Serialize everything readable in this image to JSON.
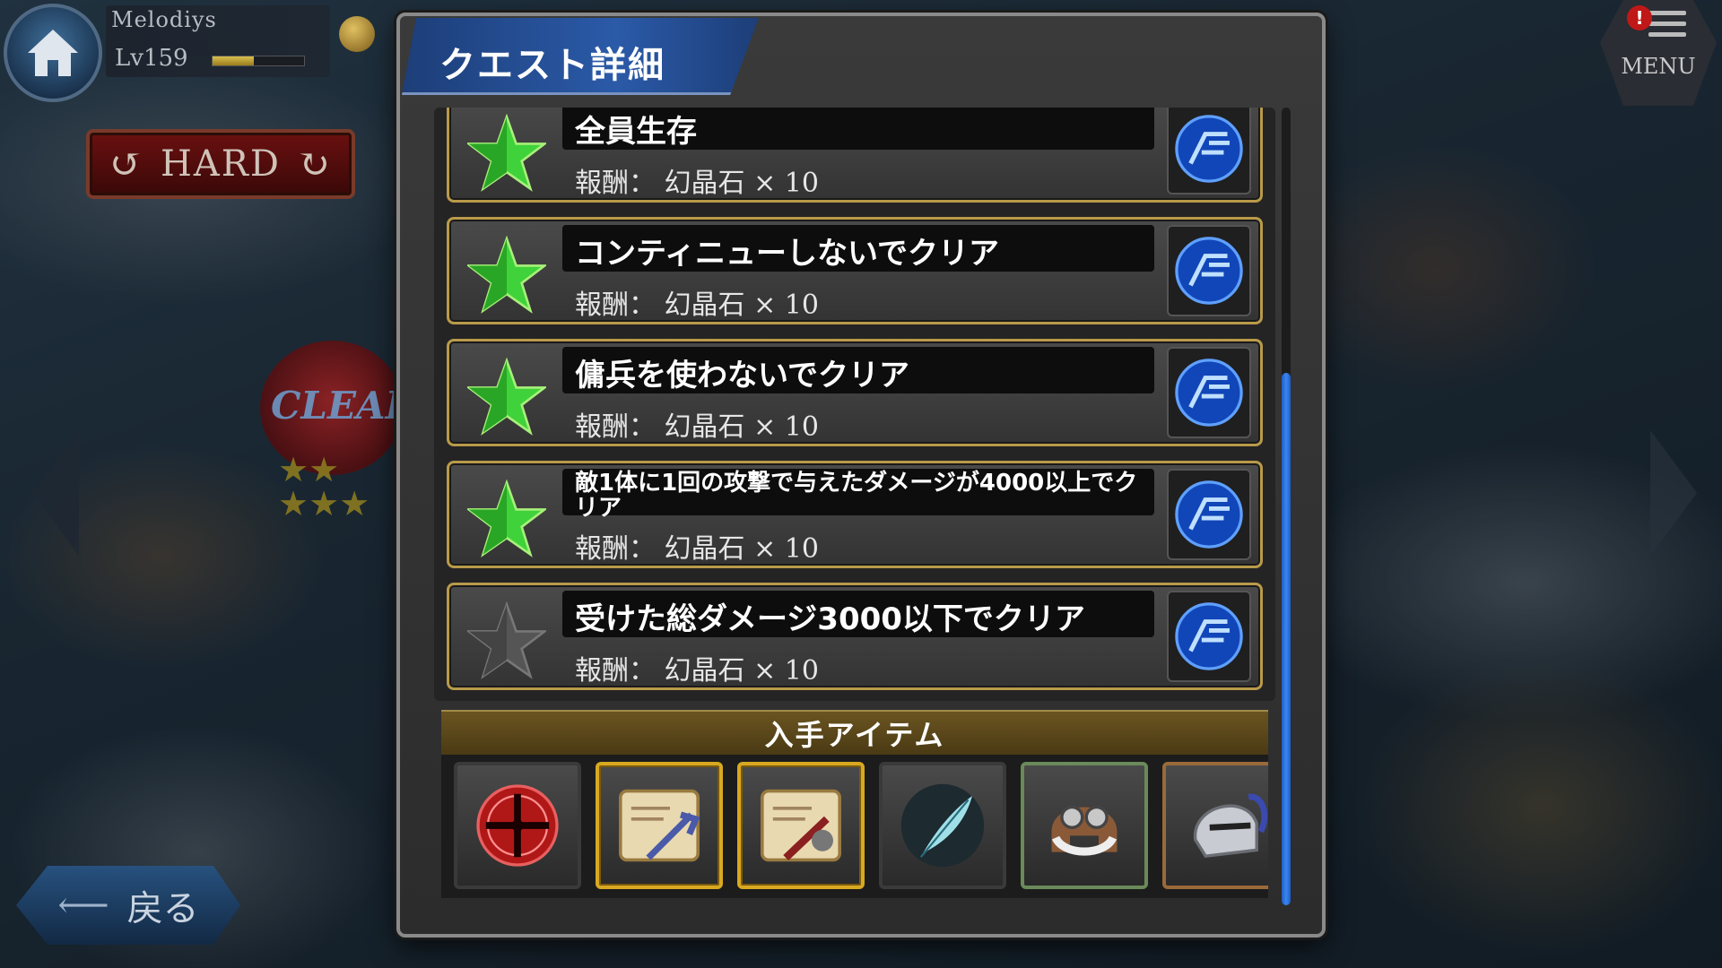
{
  "player": {
    "name": "Melodiys",
    "level": "Lv159",
    "exp_progress": 0.45
  },
  "difficulty": {
    "label": "HARD"
  },
  "clear_badge": {
    "label": "CLEAR"
  },
  "nav": {
    "back_label": "戻る",
    "menu_label": "MENU",
    "menu_alert": "!"
  },
  "dialog": {
    "title": "クエスト詳細",
    "missions": [
      {
        "name": "全員生存",
        "reward": "報酬： 幻晶石 × 10",
        "achieved": true
      },
      {
        "name": "コンティニューしないでクリア",
        "reward": "報酬： 幻晶石 × 10",
        "achieved": true
      },
      {
        "name": "傭兵を使わないでクリア",
        "reward": "報酬： 幻晶石 × 10",
        "achieved": true
      },
      {
        "name": "敵1体に1回の攻撃で与えたダメージが4000以上でクリア",
        "reward": "報酬： 幻晶石 × 10",
        "achieved": true
      },
      {
        "name": "受けた総ダメージ3000以下でクリア",
        "reward": "報酬： 幻晶石 × 10",
        "achieved": false
      }
    ],
    "items_header": "入手アイテム",
    "items": [
      {
        "icon": "red-orb-icon",
        "frame": "plain"
      },
      {
        "icon": "scroll-blue-weapon-icon",
        "frame": "gold"
      },
      {
        "icon": "scroll-red-weapon-icon",
        "frame": "gold"
      },
      {
        "icon": "feather-icon",
        "frame": "plain"
      },
      {
        "icon": "aviator-cap-icon",
        "frame": "green"
      },
      {
        "icon": "helmet-icon",
        "frame": "bronze"
      }
    ]
  },
  "colors": {
    "accent_blue": "#2b5aa8",
    "gold_frame": "#b99a4a",
    "star_achieved": "#3fd23a",
    "star_unachieved": "#555555"
  }
}
